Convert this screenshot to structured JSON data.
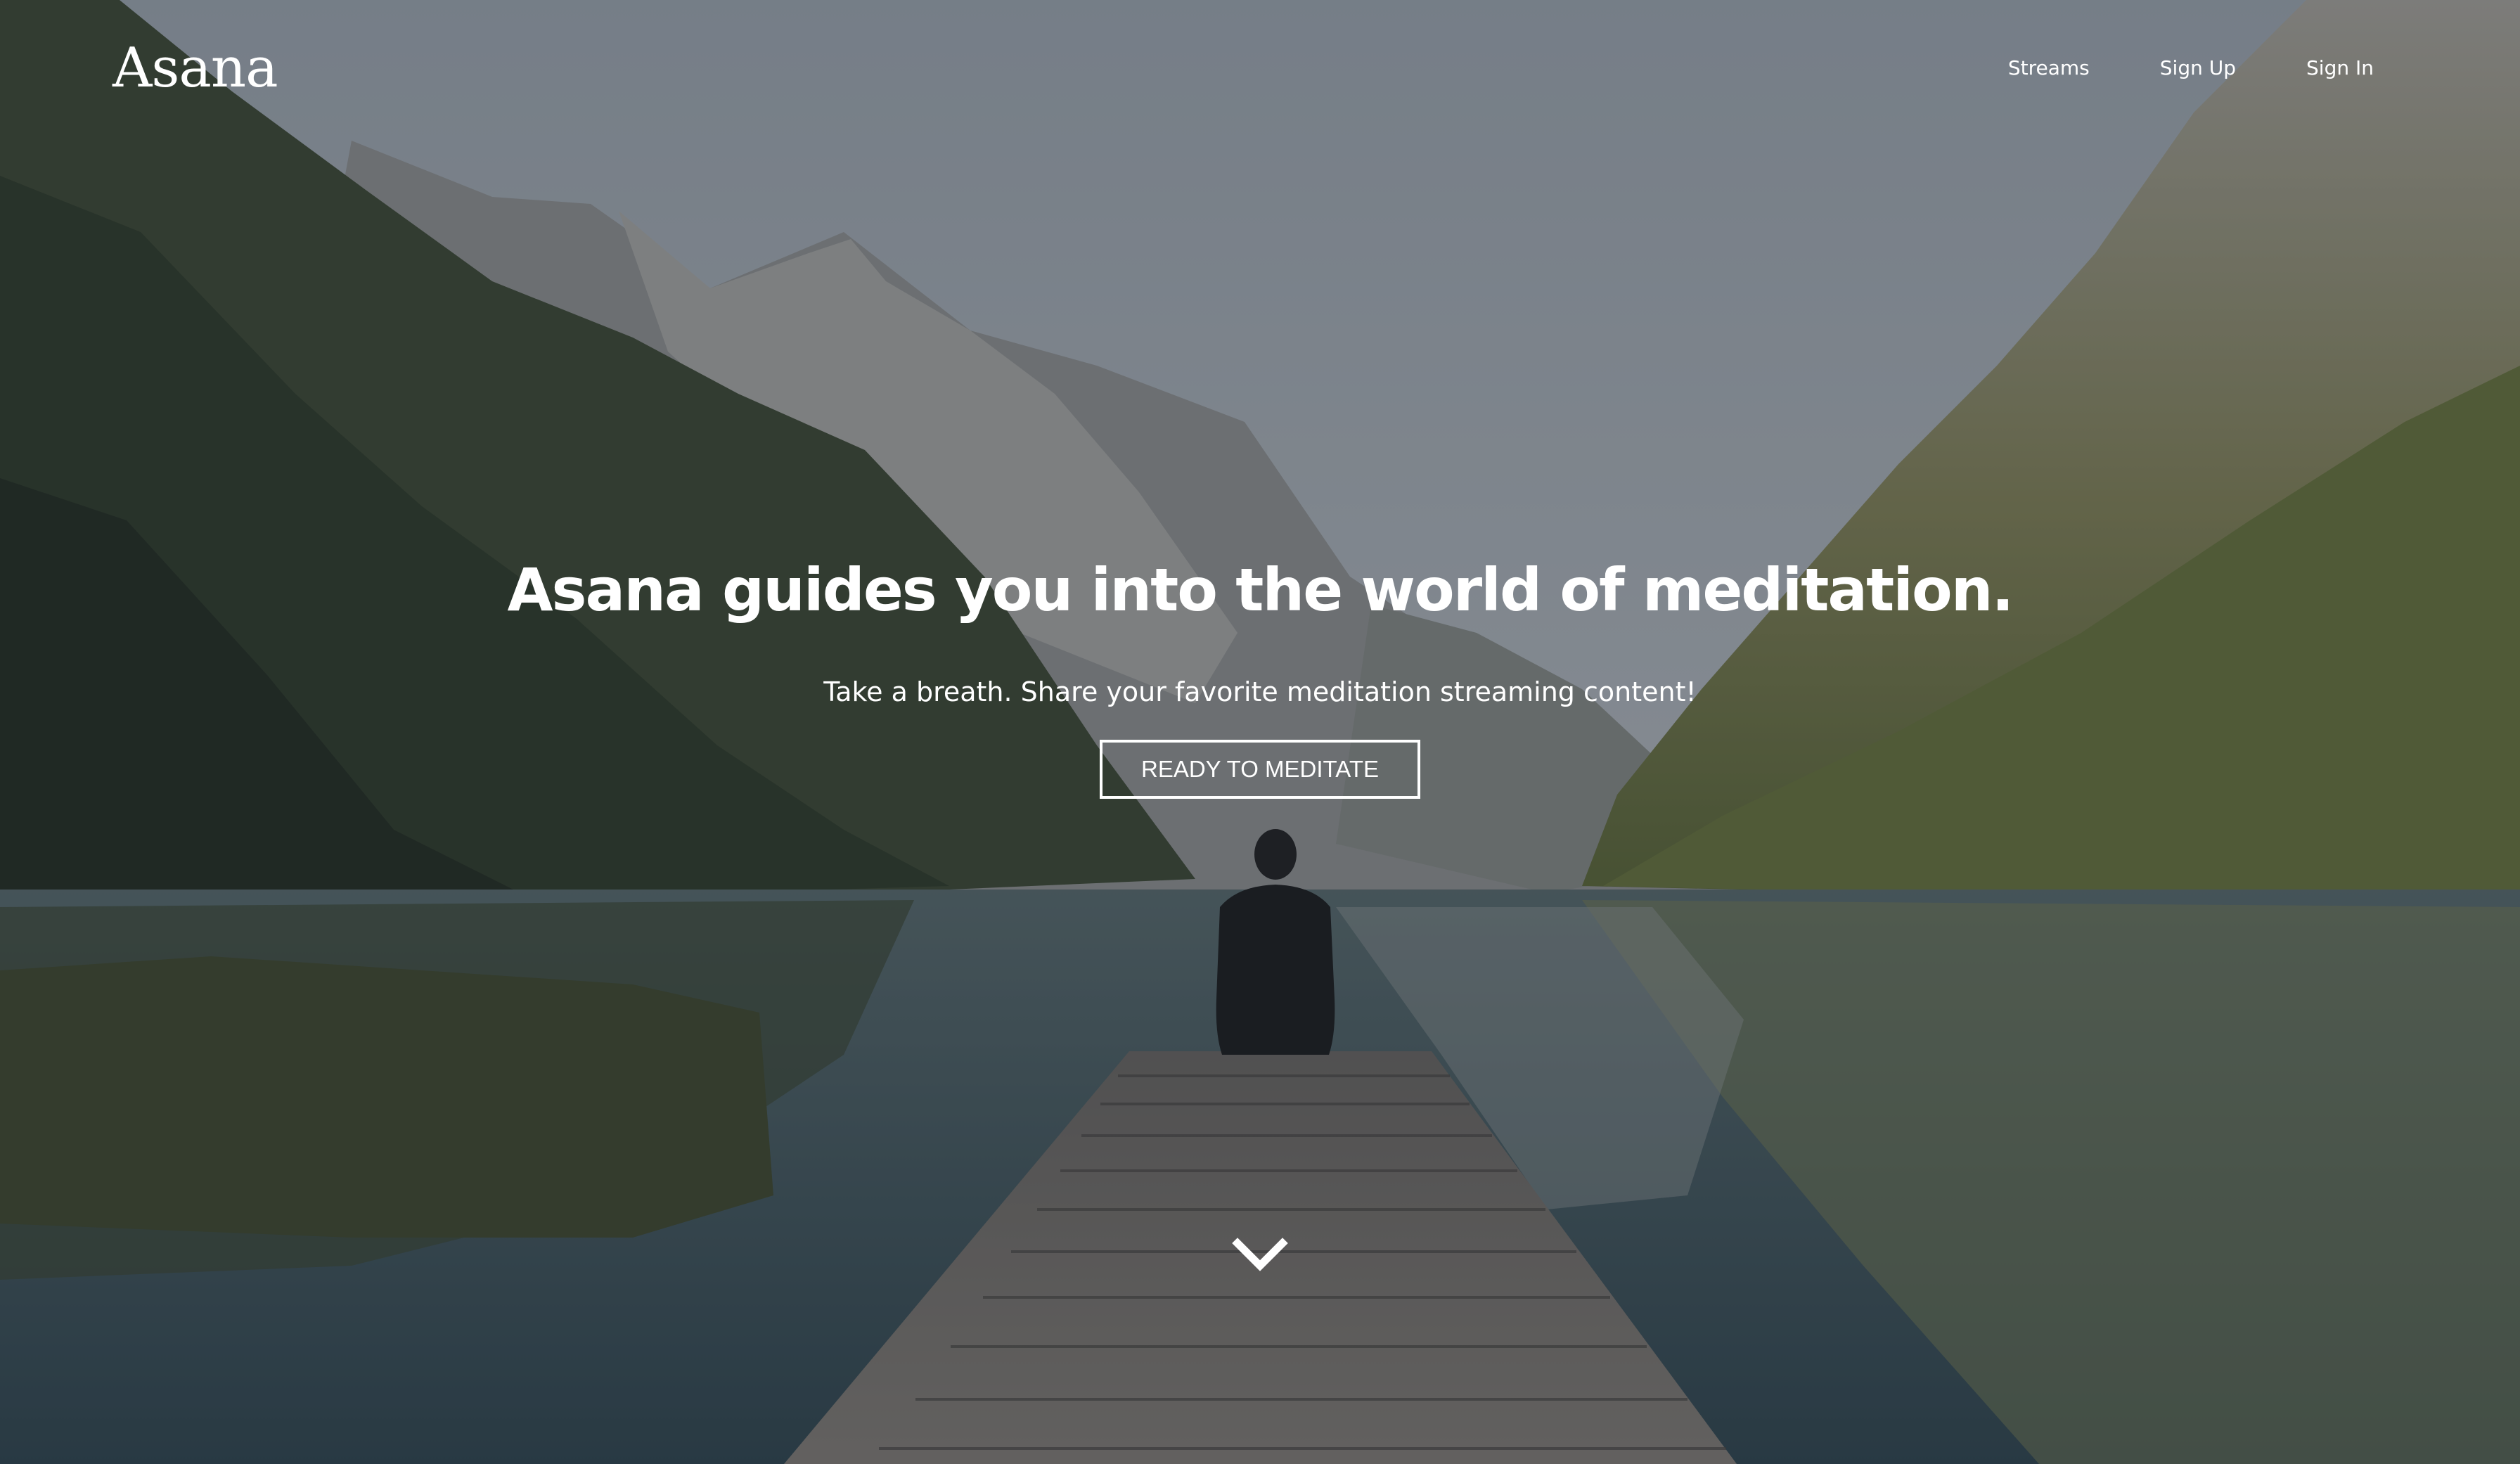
{
  "brand": {
    "logo": "Asana"
  },
  "nav": {
    "items": [
      {
        "label": "Streams"
      },
      {
        "label": "Sign Up"
      },
      {
        "label": "Sign In"
      }
    ]
  },
  "hero": {
    "headline": "Asana guides you into the world of meditation.",
    "subheadline": "Take a breath. Share your favorite meditation streaming content!",
    "cta_label": "READY TO MEDITATE",
    "scroll_icon": "chevron-down-icon",
    "background_image": "person-meditating-on-dock-mountain-lake"
  },
  "colors": {
    "text": "#ffffff",
    "overlay": "#232830"
  }
}
